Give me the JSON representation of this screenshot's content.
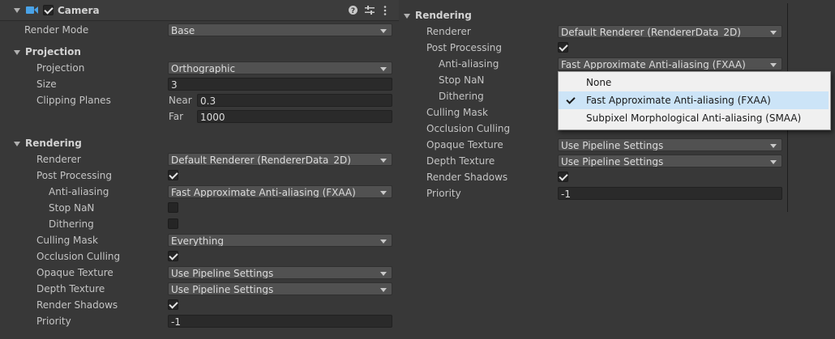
{
  "header": {
    "component_title": "Camera",
    "component_enabled": true,
    "help_icon": "help-icon",
    "preset_icon": "preset-sliders-icon",
    "menu_icon": "kebab-menu-icon"
  },
  "left": {
    "render_mode": {
      "label": "Render Mode",
      "value": "Base"
    },
    "projection_section": {
      "title": "Projection",
      "projection": {
        "label": "Projection",
        "value": "Orthographic"
      },
      "size": {
        "label": "Size",
        "value": "3"
      },
      "clipping": {
        "label": "Clipping Planes",
        "near_label": "Near",
        "near_value": "0.3",
        "far_label": "Far",
        "far_value": "1000"
      }
    },
    "rendering_section": {
      "title": "Rendering",
      "renderer": {
        "label": "Renderer",
        "value": "Default Renderer (RendererData_2D)"
      },
      "post_processing": {
        "label": "Post Processing",
        "checked": true
      },
      "anti_aliasing": {
        "label": "Anti-aliasing",
        "value": "Fast Approximate Anti-aliasing (FXAA)"
      },
      "stop_nan": {
        "label": "Stop NaN",
        "checked": false
      },
      "dithering": {
        "label": "Dithering",
        "checked": false
      },
      "culling_mask": {
        "label": "Culling Mask",
        "value": "Everything"
      },
      "occlusion_culling": {
        "label": "Occlusion Culling",
        "checked": true
      },
      "opaque_texture": {
        "label": "Opaque Texture",
        "value": "Use Pipeline Settings"
      },
      "depth_texture": {
        "label": "Depth Texture",
        "value": "Use Pipeline Settings"
      },
      "render_shadows": {
        "label": "Render Shadows",
        "checked": true
      },
      "priority": {
        "label": "Priority",
        "value": "-1"
      }
    }
  },
  "right": {
    "rendering_section": {
      "title": "Rendering",
      "renderer": {
        "label": "Renderer",
        "value": "Default Renderer (RendererData_2D)"
      },
      "post_processing": {
        "label": "Post Processing",
        "checked": true
      },
      "anti_aliasing": {
        "label": "Anti-aliasing",
        "value": "Fast Approximate Anti-aliasing (FXAA)"
      },
      "stop_nan": {
        "label": "Stop NaN"
      },
      "dithering": {
        "label": "Dithering"
      },
      "culling_mask": {
        "label": "Culling Mask"
      },
      "occlusion_culling": {
        "label": "Occlusion Culling"
      },
      "opaque_texture": {
        "label": "Opaque Texture",
        "value": "Use Pipeline Settings"
      },
      "depth_texture": {
        "label": "Depth Texture",
        "value": "Use Pipeline Settings"
      },
      "render_shadows": {
        "label": "Render Shadows",
        "checked": true
      },
      "priority": {
        "label": "Priority",
        "value": "-1"
      }
    },
    "anti_aliasing_menu": {
      "options": [
        {
          "label": "None",
          "selected": false
        },
        {
          "label": "Fast Approximate Anti-aliasing (FXAA)",
          "selected": true
        },
        {
          "label": "Subpixel Morphological Anti-aliasing (SMAA)",
          "selected": false
        }
      ]
    }
  },
  "colors": {
    "background": "#383838",
    "menu_background": "#f0f0f0",
    "menu_selected": "#cce4f7",
    "camera_icon": "#4aa3e8"
  }
}
